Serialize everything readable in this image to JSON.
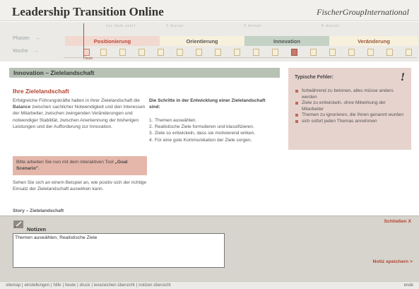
{
  "header": {
    "title": "Leadership Transition Online",
    "brand": "FischerGroupInternational"
  },
  "timeline": {
    "row_labels": {
      "phasen": "Phasen",
      "woche": "Woche"
    },
    "arrow": "→",
    "phases": [
      {
        "label": "Positionierung",
        "sub": "vor dem start",
        "color": "#c0463a",
        "bg": "#f2d9d0"
      },
      {
        "label": "Orientierung",
        "sub": "1 monat",
        "color": "#555555",
        "bg": "#f7f0dc"
      },
      {
        "label": "Innovation",
        "sub": "3 monat",
        "color": "#555555",
        "bg": "#c4d1c5"
      },
      {
        "label": "Veränderung",
        "sub": "6 monat",
        "color": "#9a5a3c",
        "bg": "#f7f0dc"
      }
    ],
    "today_label": "Heute"
  },
  "content": {
    "section_title": "Innovation – Zielelandschaft",
    "heading": "Ihre Zielelandschaft",
    "intro_parts": [
      "Erfolgreiche Führungskräfte halten in ihrer Zielelandschaft die ",
      "Balance",
      " zwischen sachlicher Notwendigkeit und den Interessen der Mitarbeiter, zwischen zwingenden Veränderungen und notwendiger Stabilität, zwischen Anerkennung der bisherigen Leistungen und der Aufforderung zur Innovation."
    ],
    "hint_parts": [
      "Bitte arbeiten Sie nun mit dem interaktiven Tool ",
      "„Goal Scenario\"",
      "."
    ],
    "after_hint": "Sehen Sie sich an einem Beispiel an, wie positiv sich der richtige Einsatz der Zielelandschaft auswirken kann.",
    "cut_text": "Story – Zielelandschaft",
    "steps_title": "Die Schritte in der Entwicklung einer Zielelandschaft sind:",
    "steps": [
      {
        "num": "1.",
        "text": "Themen auswählen."
      },
      {
        "num": "2.",
        "text": "Realistische Ziele formulieren und klassifizieren."
      },
      {
        "num": "3.",
        "text": "Ziele so entwickeln, dass sie motivierend wirken."
      },
      {
        "num": "4.",
        "text": "Für eine gute Kommunikation der Ziele sorgen."
      }
    ]
  },
  "sidebar": {
    "title": "Typische Fehler:",
    "mark": "!",
    "errors": [
      "fortwährend zu betonen, alles müsse anders werden",
      "Ziele zu entwickeln, ohne Mitwirkung der Mitarbeiter",
      "Themen zu ignorieren, die Ihnen genannt wurden",
      "sich sofort jeden Themas annehmen"
    ]
  },
  "notes": {
    "title": "Notizen",
    "close_label": "Schließen X",
    "text": "Themen auswählen, Realistische Ziele",
    "save_label": "Notiz speichern >"
  },
  "footer": {
    "links": [
      "sitemap",
      "einstellungen",
      "hilfe",
      "heute",
      "druck",
      "lesezeichen übersicht",
      "notizen übersicht"
    ],
    "separator": "|",
    "end_label": "ende"
  },
  "colors": {
    "accent_red": "#b24430",
    "section_green": "#b7c2b5",
    "sidebar_pink": "#e7d3cd",
    "hint_pink": "#e5b6aa"
  }
}
